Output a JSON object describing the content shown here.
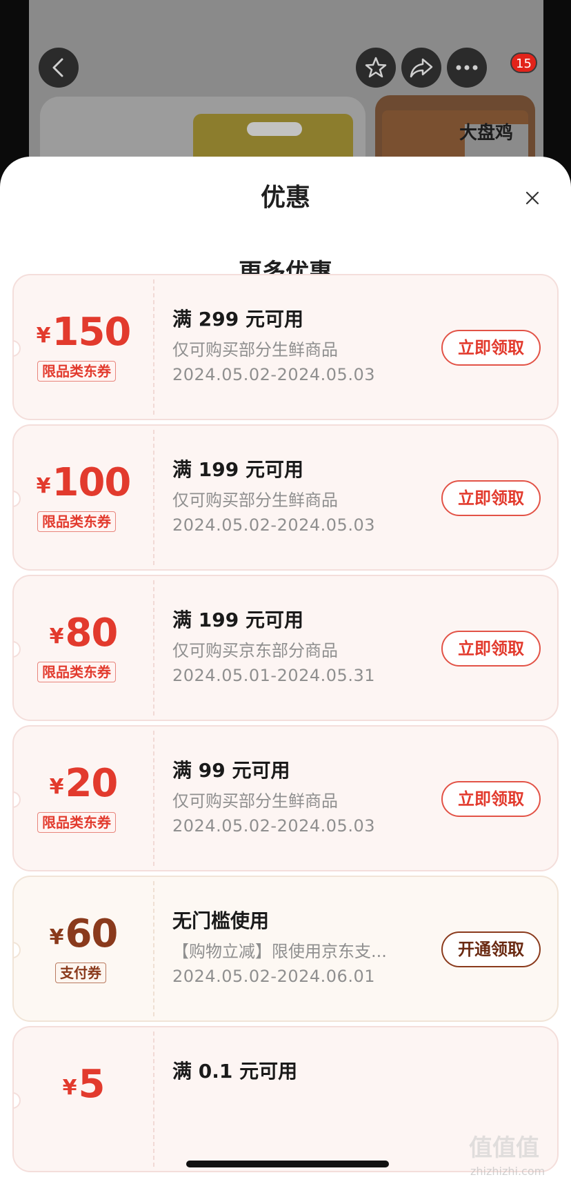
{
  "background": {
    "brand_text": "大盘鸡",
    "badge_count": "15"
  },
  "sheet": {
    "title": "优惠",
    "section_title": "更多优惠"
  },
  "coupons": [
    {
      "currency": "¥",
      "amount": "150",
      "tag": "限品类东券",
      "condition": "满 299 元可用",
      "scope": "仅可购买部分生鲜商品",
      "dates": "2024.05.02-2024.05.03",
      "button": "立即领取"
    },
    {
      "currency": "¥",
      "amount": "100",
      "tag": "限品类东券",
      "condition": "满 199 元可用",
      "scope": "仅可购买部分生鲜商品",
      "dates": "2024.05.02-2024.05.03",
      "button": "立即领取"
    },
    {
      "currency": "¥",
      "amount": "80",
      "tag": "限品类东券",
      "condition": "满 199 元可用",
      "scope": "仅可购买京东部分商品",
      "dates": "2024.05.01-2024.05.31",
      "button": "立即领取"
    },
    {
      "currency": "¥",
      "amount": "20",
      "tag": "限品类东券",
      "condition": "满 99 元可用",
      "scope": "仅可购买部分生鲜商品",
      "dates": "2024.05.02-2024.05.03",
      "button": "立即领取"
    },
    {
      "currency": "¥",
      "amount": "60",
      "tag": "支付券",
      "condition": "无门槛使用",
      "scope": "【购物立减】限使用京东支...",
      "dates": "2024.05.02-2024.06.01",
      "button": "开通领取"
    },
    {
      "currency": "¥",
      "amount": "5",
      "tag": "",
      "condition": "满 0.1 元可用",
      "scope": "",
      "dates": "",
      "button": ""
    }
  ],
  "watermark": {
    "text": "值值值",
    "sub": "zhizhizhi.com"
  },
  "colors": {
    "accent_red": "#e23a2d",
    "pay_brown": "#8a3a1c",
    "coupon_bg": "#fdf5f3"
  }
}
